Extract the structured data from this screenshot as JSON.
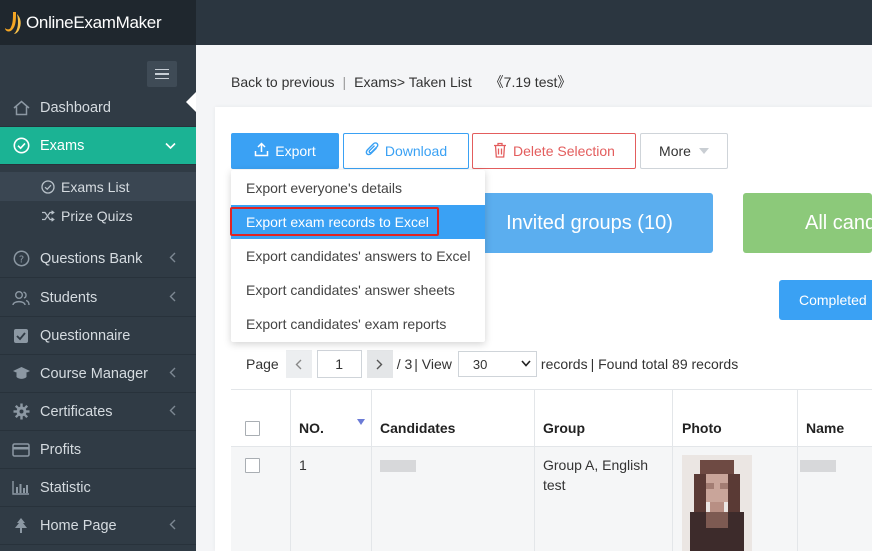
{
  "app": {
    "brand": "OnlineExamMaker"
  },
  "sidebar": {
    "items": [
      {
        "label": "Dashboard",
        "icon": "home-icon"
      },
      {
        "label": "Exams",
        "icon": "check-circle-icon"
      },
      {
        "label": "Questions Bank",
        "icon": "question-circle-icon"
      },
      {
        "label": "Students",
        "icon": "users-icon"
      },
      {
        "label": "Questionnaire",
        "icon": "checkbox-icon"
      },
      {
        "label": "Course Manager",
        "icon": "graduation-cap-icon"
      },
      {
        "label": "Certificates",
        "icon": "gear-icon"
      },
      {
        "label": "Profits",
        "icon": "credit-card-icon"
      },
      {
        "label": "Statistic",
        "icon": "bar-chart-icon"
      },
      {
        "label": "Home Page",
        "icon": "tree-icon"
      }
    ],
    "sub_items": [
      {
        "label": "Exams List",
        "icon": "check-circle-icon"
      },
      {
        "label": "Prize Quizs",
        "icon": "shuffle-icon"
      }
    ],
    "active": "Exams",
    "accent": "#1bb394"
  },
  "breadcrumb": {
    "back": "Back to previous",
    "sep": "|",
    "path": "Exams> Taken List",
    "exam": "《7.19 test》"
  },
  "toolbar": {
    "export": "Export",
    "download": "Download",
    "delete": "Delete Selection",
    "more": "More"
  },
  "export_menu": [
    "Export everyone's details",
    "Export exam records to Excel",
    "Export candidates' answers to Excel",
    "Export candidates' answer sheets",
    "Export candidates' exam reports"
  ],
  "tiles": {
    "invited": "Invited groups (10)",
    "all": "All cand"
  },
  "filter": {
    "completed": "Completed"
  },
  "pager": {
    "page_label": "Page",
    "current": "1",
    "total": "/ 3",
    "view_label": "| View",
    "per_page": "30",
    "records_label": "records",
    "found": "| Found total 89 records"
  },
  "table": {
    "headers": [
      "NO.",
      "Candidates",
      "Group",
      "Photo",
      "Name"
    ],
    "rows": [
      {
        "no": "1",
        "group": "Group A, English test"
      }
    ]
  },
  "colors": {
    "primary": "#3aa1f4",
    "danger": "#e35d5d",
    "invited_tile": "#5baeef",
    "all_tile": "#8cc97a",
    "topbar": "#2b3640"
  }
}
